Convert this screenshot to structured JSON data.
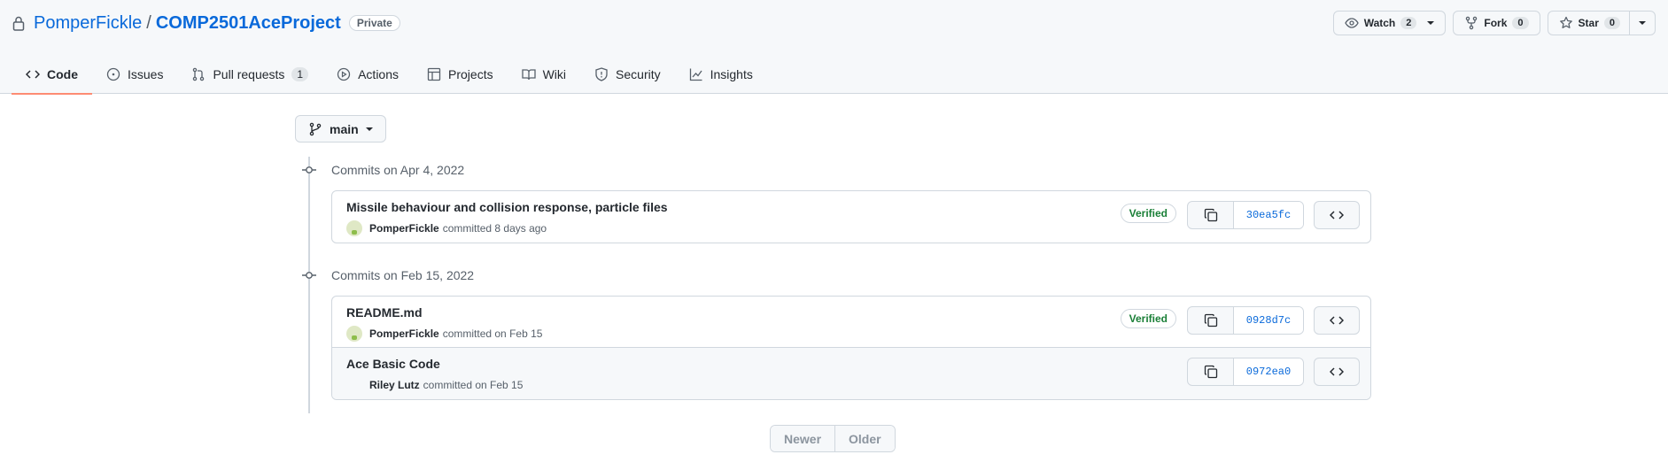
{
  "repo": {
    "owner": "PomperFickle",
    "separator": "/",
    "name": "COMP2501AceProject",
    "visibility": "Private"
  },
  "actions": {
    "watch": {
      "label": "Watch",
      "count": "2"
    },
    "fork": {
      "label": "Fork",
      "count": "0"
    },
    "star": {
      "label": "Star",
      "count": "0"
    }
  },
  "tabs": [
    {
      "label": "Code",
      "icon": "code-icon",
      "active": true
    },
    {
      "label": "Issues",
      "icon": "issue-icon"
    },
    {
      "label": "Pull requests",
      "icon": "pull-request-icon",
      "count": "1"
    },
    {
      "label": "Actions",
      "icon": "play-icon"
    },
    {
      "label": "Projects",
      "icon": "table-icon"
    },
    {
      "label": "Wiki",
      "icon": "book-icon"
    },
    {
      "label": "Security",
      "icon": "shield-icon"
    },
    {
      "label": "Insights",
      "icon": "graph-icon"
    }
  ],
  "branch": {
    "name": "main"
  },
  "commit_groups": [
    {
      "heading": "Commits on Apr 4, 2022",
      "commits": [
        {
          "message": "Missile behaviour and collision response, particle files",
          "author": "PomperFickle",
          "meta": "committed 8 days ago",
          "verified": "Verified",
          "sha": "30ea5fc"
        }
      ]
    },
    {
      "heading": "Commits on Feb 15, 2022",
      "commits": [
        {
          "message": "README.md",
          "author": "PomperFickle",
          "meta": "committed on Feb 15",
          "verified": "Verified",
          "sha": "0928d7c"
        },
        {
          "message": "Ace Basic Code",
          "author": "Riley Lutz",
          "meta": "committed on Feb 15",
          "sha": "0972ea0"
        }
      ]
    }
  ],
  "pagination": {
    "newer": "Newer",
    "older": "Older"
  },
  "colors": {
    "link": "#0969da",
    "verified": "#1a7f37",
    "active_tab_underline": "#fd8c73"
  }
}
